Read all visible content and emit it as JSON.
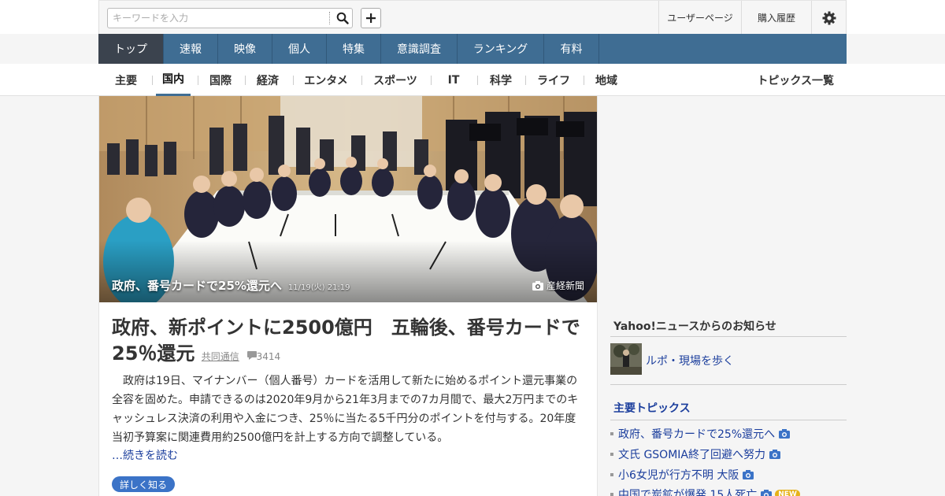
{
  "search": {
    "placeholder": "キーワードを入力"
  },
  "util": {
    "user_page": "ユーザーページ",
    "purchase_history": "購入履歴"
  },
  "nav": {
    "tabs": [
      "トップ",
      "速報",
      "映像",
      "個人",
      "特集",
      "意識調査",
      "ランキング",
      "有料"
    ]
  },
  "subnav": {
    "tabs": [
      "主要",
      "国内",
      "国際",
      "経済",
      "エンタメ",
      "スポーツ",
      "IT",
      "科学",
      "ライフ",
      "地域"
    ],
    "topics_list": "トピックス一覧"
  },
  "hero": {
    "title": "政府、番号カードで25%還元へ",
    "time": "11/19(火) 21:19",
    "source": "産経新聞"
  },
  "article": {
    "headline": "政府、新ポイントに2500億円　五輪後、番号カードで25％還元",
    "source": "共同通信",
    "comments": "3414",
    "summary": "政府は19日、マイナンバー（個人番号）カードを活用して新たに始めるポイント還元事業の全容を固めた。申請できるのは2020年9月から21年3月までの7カ月間で、最大2万円までのキャッシュレス決済の利用や入金につき、25％に当たる5千円分のポイントを付与する。20年度当初予算案に関連費用約2500億円を計上する方向で調整している。",
    "read_more": "…続きを読む",
    "detail_button": "詳しく知る"
  },
  "sidebar": {
    "notice_heading": "Yahoo!ニュースからのお知らせ",
    "notice_item": "ルポ・現場を歩く",
    "topics_heading": "主要トピックス",
    "topics": [
      {
        "label": "政府、番号カードで25%還元へ",
        "photo": true,
        "new": false
      },
      {
        "label": "文氏 GSOMIA終了回避へ努力",
        "photo": true,
        "new": false
      },
      {
        "label": "小6女児が行方不明 大阪",
        "photo": true,
        "new": false
      },
      {
        "label": "中国で炭鉱が爆発 15人死亡",
        "photo": true,
        "new": true
      }
    ],
    "new_badge": "NEW"
  },
  "colors": {
    "nav_bg": "#3f6d93",
    "nav_active": "#3b434e",
    "link": "#1a3d9c",
    "button": "#3b73c7",
    "new_badge": "#e6b21a"
  }
}
